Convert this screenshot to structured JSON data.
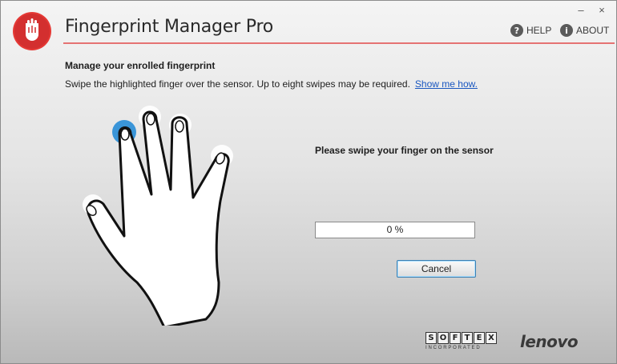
{
  "window": {
    "title": "Fingerprint Manager Pro",
    "minimize_glyph": "–",
    "close_glyph": "×"
  },
  "header": {
    "help_label": "HELP",
    "about_label": "ABOUT",
    "help_icon": "?",
    "about_icon": "i"
  },
  "content": {
    "heading": "Manage your enrolled fingerprint",
    "instruction": "Swipe the highlighted finger over the sensor. Up to eight swipes may be required.",
    "show_me_link": "Show me how.",
    "status_text": "Please swipe your finger on the sensor",
    "progress_text": "0 %",
    "progress_value": 0,
    "cancel_label": "Cancel",
    "highlighted_finger": "index"
  },
  "branding": {
    "softex_letters": [
      "S",
      "O",
      "F",
      "T",
      "E",
      "X"
    ],
    "softex_sub": "INCORPORATED",
    "lenovo": "lenovo"
  },
  "colors": {
    "accent_red": "#e53935",
    "title_rule": "#e57373",
    "link_blue": "#1a57c0",
    "finger_highlight": "#3a95d8"
  }
}
